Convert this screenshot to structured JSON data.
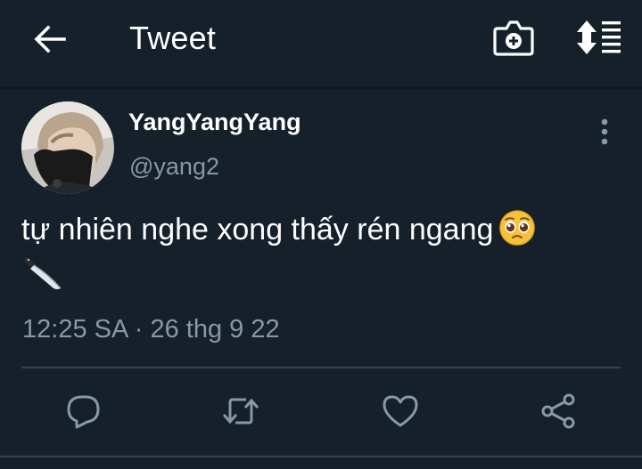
{
  "header": {
    "title": "Tweet",
    "back_icon": "arrow-left-icon",
    "camera_icon": "camera-plus-icon",
    "sort_icon": "sort-list-icon"
  },
  "tweet": {
    "display_name": "YangYangYang",
    "handle": "@yang2",
    "text": "tự nhiên nghe xong thấy rén ngang",
    "emojis": [
      "pleading-face-emoji",
      "kitchen-knife-emoji"
    ],
    "timestamp": "12:25 SA · 26 thg 9 22"
  },
  "actions": [
    "reply-icon",
    "retweet-icon",
    "like-icon",
    "share-icon"
  ],
  "colors": {
    "background": "#15202b",
    "text_primary": "#ffffff",
    "text_secondary": "#8899a6",
    "divider": "#38444d"
  }
}
